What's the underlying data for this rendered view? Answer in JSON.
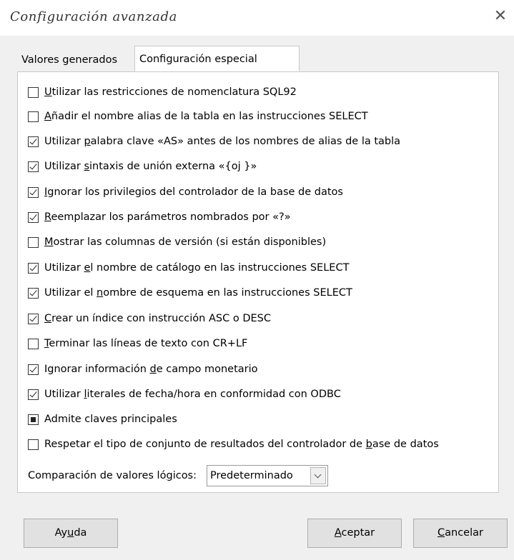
{
  "dialog": {
    "title": "Configuración avanzada",
    "close_glyph": "✕"
  },
  "tabs": [
    {
      "label": "Valores generados",
      "active": false
    },
    {
      "label": "Configuración especial",
      "active": true
    }
  ],
  "options": [
    {
      "pre": "",
      "key": "U",
      "post": "tilizar las restricciones de nomenclatura SQL92",
      "state": "unchecked"
    },
    {
      "pre": "",
      "key": "A",
      "post": "ñadir el nombre alias de la tabla en las instrucciones SELECT",
      "state": "unchecked"
    },
    {
      "pre": "Utilizar ",
      "key": "p",
      "post": "alabra clave «AS» antes de los nombres de alias de la tabla",
      "state": "checked"
    },
    {
      "pre": "Utilizar ",
      "key": "s",
      "post": "intaxis de unión externa «{oj }»",
      "state": "checked"
    },
    {
      "pre": "",
      "key": "I",
      "post": "gnorar los privilegios del controlador de la base de datos",
      "state": "checked"
    },
    {
      "pre": "",
      "key": "R",
      "post": "eemplazar los parámetros nombrados por «?»",
      "state": "checked"
    },
    {
      "pre": "",
      "key": "M",
      "post": "ostrar las columnas de versión (si están disponibles)",
      "state": "unchecked"
    },
    {
      "pre": "Utilizar ",
      "key": "e",
      "post": "l nombre de catálogo en las instrucciones SELECT",
      "state": "checked"
    },
    {
      "pre": "Utilizar el ",
      "key": "n",
      "post": "ombre de esquema en las instrucciones SELECT",
      "state": "checked"
    },
    {
      "pre": "",
      "key": "C",
      "post": "rear un índice con instrucción ASC o DESC",
      "state": "checked"
    },
    {
      "pre": "",
      "key": "T",
      "post": "erminar las líneas de texto con CR+LF",
      "state": "unchecked"
    },
    {
      "pre": "Ignorar información ",
      "key": "d",
      "post": "e campo monetario",
      "state": "checked"
    },
    {
      "pre": "Utilizar ",
      "key": "l",
      "post": "iterales de fecha/hora en conformidad con ODBC",
      "state": "checked"
    },
    {
      "pre": "Admite claves principales",
      "key": "",
      "post": "",
      "state": "indeterminate"
    },
    {
      "pre": "Respetar el tipo de conjunto de resultados del controlador de ",
      "key": "b",
      "post": "ase de datos",
      "state": "unchecked"
    }
  ],
  "comparison": {
    "label_pre": "Comparación de valores ló",
    "label_key": "g",
    "label_post": "icos:",
    "value": "Predeterminado"
  },
  "buttons": {
    "help": {
      "pre": "Ay",
      "key": "u",
      "post": "da"
    },
    "ok": {
      "pre": "",
      "key": "A",
      "post": "ceptar"
    },
    "cancel": {
      "pre": "",
      "key": "C",
      "post": "ancelar"
    }
  }
}
